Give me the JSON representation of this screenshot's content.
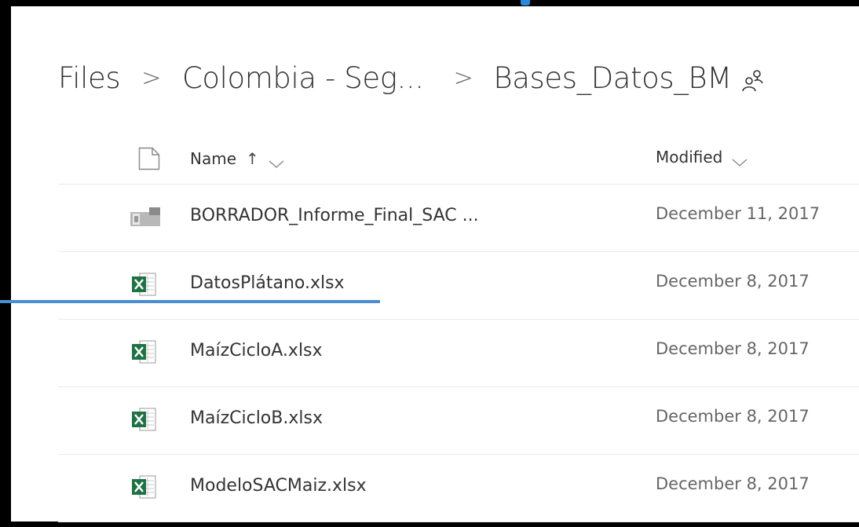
{
  "breadcrumb": {
    "items": [
      "Files",
      "Colombia - Seg...",
      "Bases_Datos_BM"
    ],
    "separator": ">"
  },
  "columns": {
    "file_type_icon": "document-icon",
    "name": "Name",
    "name_sort_indicator": "↑",
    "modified": "Modified"
  },
  "rows": [
    {
      "name": "BORRADOR_Informe_Final_SAC ...",
      "modified": "December 11, 2017",
      "icon": "generic-file-icon"
    },
    {
      "name": "DatosPlátano.xlsx",
      "modified": "December 8, 2017",
      "icon": "excel-icon"
    },
    {
      "name": "MaízCicloA.xlsx",
      "modified": "December 8, 2017",
      "icon": "excel-icon"
    },
    {
      "name": "MaízCicloB.xlsx",
      "modified": "December 8, 2017",
      "icon": "excel-icon"
    },
    {
      "name": "ModeloSACMaiz.xlsx",
      "modified": "December 8, 2017",
      "icon": "excel-icon"
    }
  ],
  "colors": {
    "accent": "#2b88d8",
    "excel_green": "#207245",
    "annotation_line": "#4a8ed0"
  }
}
